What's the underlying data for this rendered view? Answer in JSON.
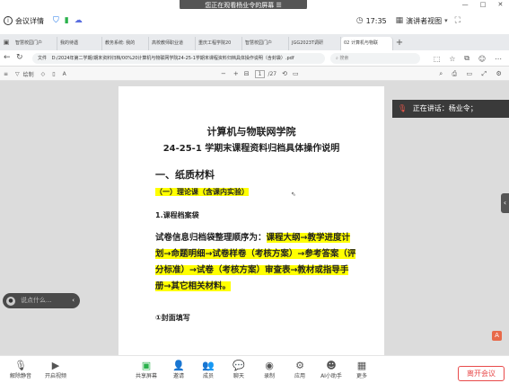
{
  "banner": {
    "text": "您正在观看杨业令的屏幕"
  },
  "topbar": {
    "meeting_label": "会议详情",
    "time": "17:35",
    "view_label": "演讲者视图",
    "window_min": "—",
    "window_max": "□",
    "window_close": "✕"
  },
  "tabs": [
    {
      "label": "智慧校园门户"
    },
    {
      "label": "我的待遇"
    },
    {
      "label": "教务系统: 我的"
    },
    {
      "label": "高校教师职业道"
    },
    {
      "label": "重庆工程学院20"
    },
    {
      "label": "智慧校园门户"
    },
    {
      "label": "JGG2023T调研"
    },
    {
      "label": "02 计算机与物联"
    }
  ],
  "address": {
    "file_label": "文件",
    "url": "D:/2024年第二学期/期末资料归档/00%20计算机与物联网学院24-25-1学期末课程资料归档具体操作说明（含封袋）.pdf",
    "search_placeholder": "搜索"
  },
  "pdf_toolbar": {
    "draw_label": "绘制",
    "zoom_minus": "−",
    "zoom_plus": "+",
    "page_current": "1",
    "page_total": "/27"
  },
  "document": {
    "title": "计算机与物联网学院",
    "subtitle": "24-25-1 学期末课程资料归档具体操作说明",
    "section1": "一、纸质材料",
    "subsection": "（一）理论课（含课内实验）",
    "item1": "1.课程档案袋",
    "para_lead": "试卷信息归档袋整理顺序为：",
    "para_line1": "课程大纲→教学进度计",
    "para_line2": "划→命题明细→试卷样卷（考核方案）→参考答案（评",
    "para_line3": "分标准）→试卷（考核方案）审查表→教材或指导手",
    "para_line4": "册→其它相关材料。",
    "item2": "①封面填写"
  },
  "notice": {
    "text": "正在讲话：杨业令；"
  },
  "chat": {
    "placeholder": "说点什么..."
  },
  "bottom": {
    "items": [
      "解除静音",
      "开启视频",
      "共享屏幕",
      "邀请",
      "成员",
      "聊天",
      "录制",
      "应用",
      "AI小助手",
      "更多"
    ],
    "leave_label": "离开会议"
  },
  "colors": {
    "accent": "#1a73e8",
    "highlight": "#ffff00",
    "leave": "#e84a4a"
  }
}
